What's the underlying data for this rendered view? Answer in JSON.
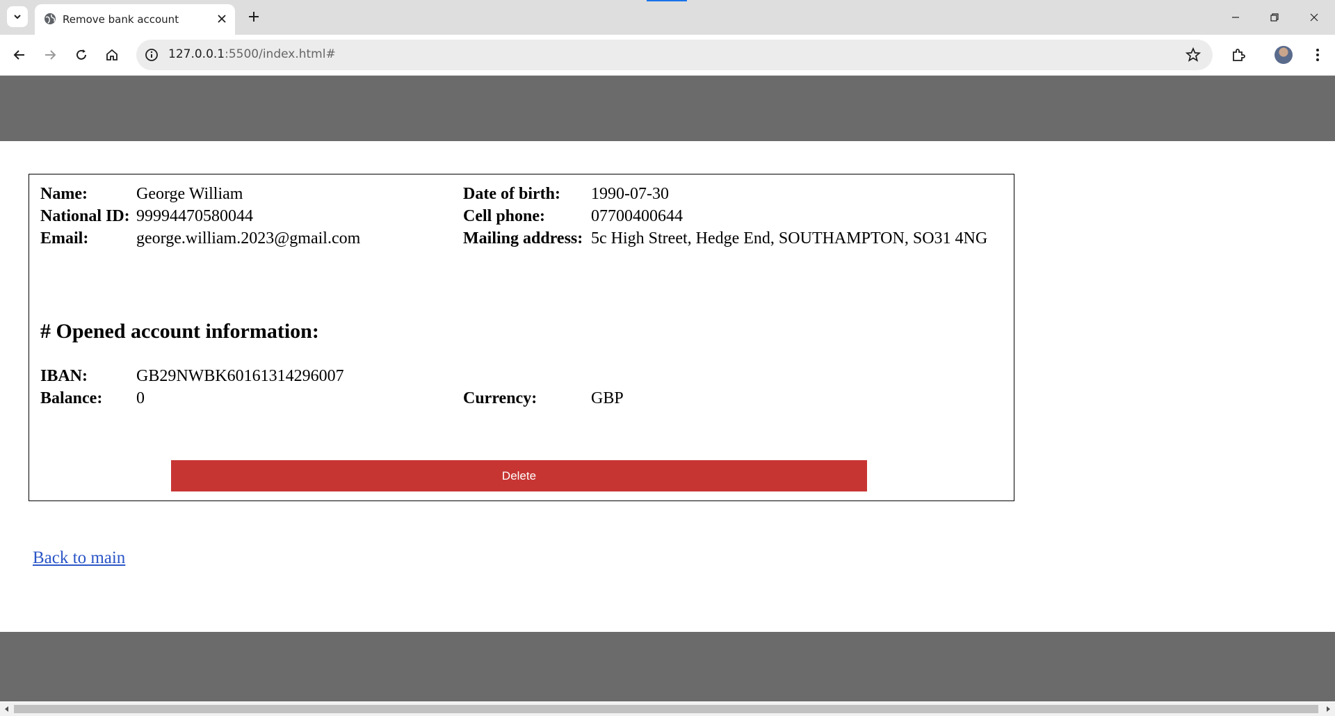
{
  "browser": {
    "tab_title": "Remove bank account",
    "url_host": "127.0.0.1",
    "url_rest": ":5500/index.html#"
  },
  "customer": {
    "name_label": "Name:",
    "name_value": "George William",
    "national_id_label": "National ID:",
    "national_id_value": "99994470580044",
    "email_label": "Email:",
    "email_value": "george.william.2023@gmail.com",
    "dob_label": "Date of birth:",
    "dob_value": "1990-07-30",
    "phone_label": "Cell phone:",
    "phone_value": "07700400644",
    "address_label": "Mailing address:",
    "address_value": "5c High Street, Hedge End, SOUTHAMPTON, SO31 4NG"
  },
  "account": {
    "section_title": "# Opened account information:",
    "iban_label": "IBAN:",
    "iban_value": "GB29NWBK60161314296007",
    "balance_label": "Balance:",
    "balance_value": "0",
    "currency_label": "Currency:",
    "currency_value": "GBP"
  },
  "actions": {
    "delete_label": "Delete",
    "back_link": "Back to main"
  },
  "colors": {
    "header_footer": "#6b6b6b",
    "delete_button": "#c73532",
    "link": "#2a55c7"
  }
}
